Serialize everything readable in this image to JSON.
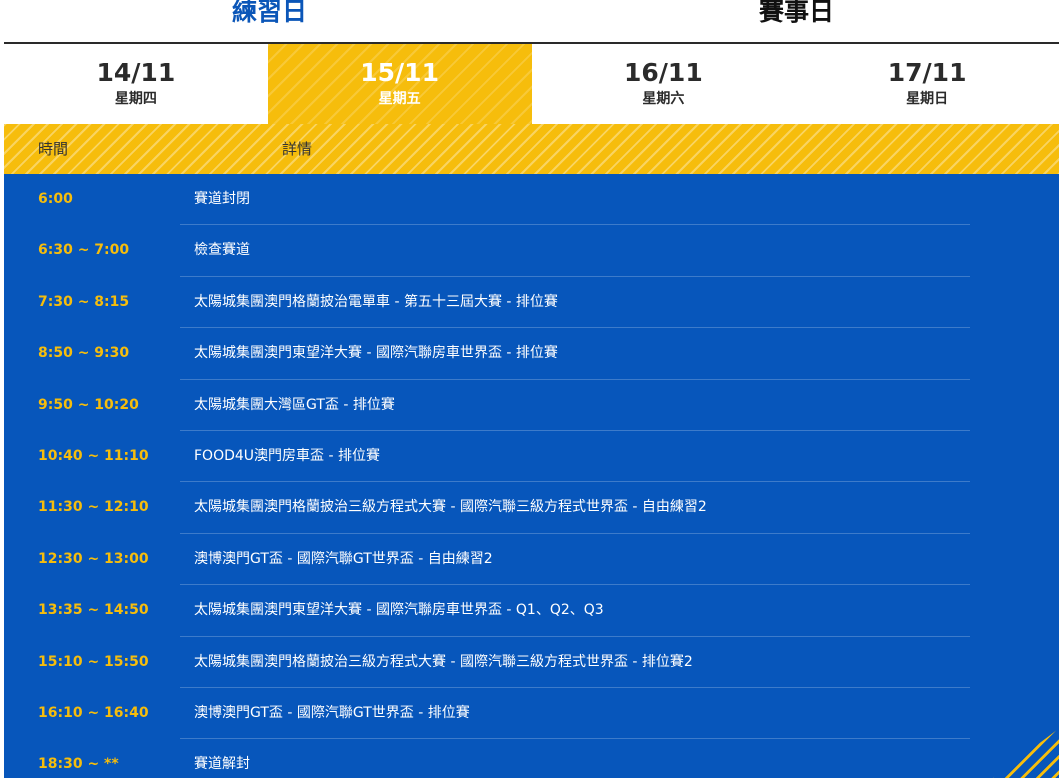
{
  "sections": {
    "practice_label": "練習日",
    "race_label": "賽事日"
  },
  "days": [
    {
      "date": "14/11",
      "weekday": "星期四",
      "active": false
    },
    {
      "date": "15/11",
      "weekday": "星期五",
      "active": true
    },
    {
      "date": "16/11",
      "weekday": "星期六",
      "active": false
    },
    {
      "date": "17/11",
      "weekday": "星期日",
      "active": false
    }
  ],
  "table": {
    "time_header": "時間",
    "detail_header": "詳情",
    "rows": [
      {
        "time": "6:00",
        "detail": "賽道封閉"
      },
      {
        "time": "6:30 ~ 7:00",
        "detail": "檢查賽道"
      },
      {
        "time": "7:30 ~ 8:15",
        "detail": "太陽城集團澳門格蘭披治電單車 - 第五十三屆大賽 - 排位賽"
      },
      {
        "time": "8:50 ~ 9:30",
        "detail": "太陽城集團澳門東望洋大賽 - 國際汽聯房車世界盃 - 排位賽"
      },
      {
        "time": "9:50 ~ 10:20",
        "detail": "太陽城集團大灣區GT盃 - 排位賽"
      },
      {
        "time": "10:40 ~ 11:10",
        "detail": "FOOD4U澳門房車盃 - 排位賽"
      },
      {
        "time": "11:30 ~ 12:10",
        "detail": "太陽城集團澳門格蘭披治三級方程式大賽 - 國際汽聯三級方程式世界盃 - 自由練習2"
      },
      {
        "time": "12:30 ~ 13:00",
        "detail": "澳博澳門GT盃 - 國際汽聯GT世界盃 - 自由練習2"
      },
      {
        "time": "13:35 ~ 14:50",
        "detail": "太陽城集團澳門東望洋大賽 - 國際汽聯房車世界盃 - Q1、Q2、Q3"
      },
      {
        "time": "15:10 ~ 15:50",
        "detail": "太陽城集團澳門格蘭披治三級方程式大賽 - 國際汽聯三級方程式世界盃 - 排位賽2"
      },
      {
        "time": "16:10 ~ 16:40",
        "detail": "澳博澳門GT盃 - 國際汽聯GT世界盃 - 排位賽"
      },
      {
        "time": "18:30 ~ **",
        "detail": "賽道解封"
      }
    ]
  },
  "colors": {
    "accent_yellow": "#f6bd0c",
    "schedule_blue": "#0756bb",
    "practice_blue": "#0b56b8"
  }
}
